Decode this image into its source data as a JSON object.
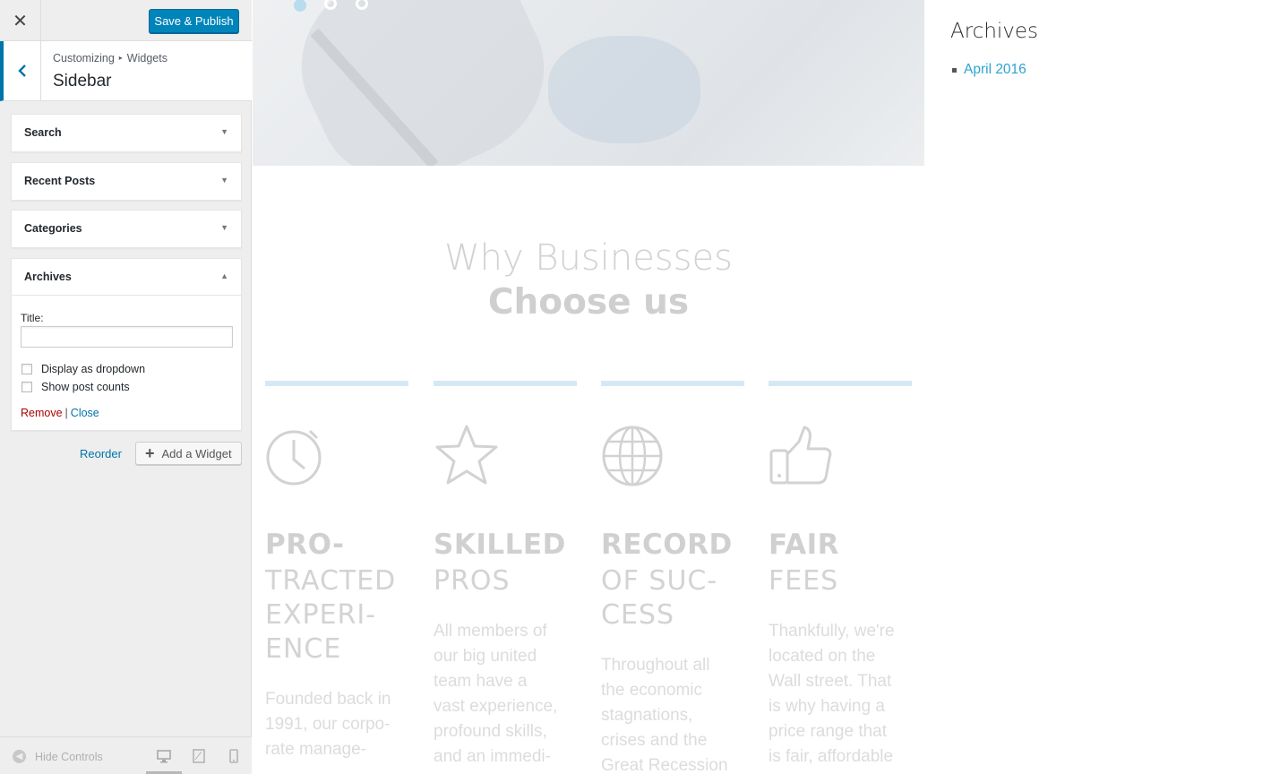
{
  "topbar": {
    "close_icon": "close-icon",
    "save_label": "Save & Publish"
  },
  "section": {
    "crumb_root": "Customizing",
    "crumb_child": "Widgets",
    "title": "Sidebar"
  },
  "widgets": [
    {
      "title": "Search",
      "expanded": false
    },
    {
      "title": "Recent Posts",
      "expanded": false
    },
    {
      "title": "Categories",
      "expanded": false
    },
    {
      "title": "Archives",
      "expanded": true
    }
  ],
  "archives_form": {
    "title_label": "Title:",
    "title_value": "",
    "cb_dropdown": "Display as dropdown",
    "cb_counts": "Show post counts",
    "remove": "Remove",
    "pipe": "|",
    "close": "Close"
  },
  "actions": {
    "reorder": "Reorder",
    "add_widget": "Add a Widget"
  },
  "footer": {
    "hide_controls": "Hide Controls"
  },
  "preview": {
    "why_title": "Why Businesses",
    "why_sub": "Choose us",
    "features": [
      {
        "icon": "stopwatch-icon",
        "head1": "PRO-",
        "head2": "TRACTED\nEXPERI-\nENCE",
        "body": "Founded back in\n1991, our corpo-\nrate manage-"
      },
      {
        "icon": "star-icon",
        "head1": "SKILLED",
        "head2": "PROS",
        "body": "All members of\nour big united\nteam have a\nvast experience,\nprofound skills,\nand an immedi-"
      },
      {
        "icon": "globe-icon",
        "head1": "RECORD",
        "head2": "OF SUC-\nCESS",
        "body": "Throughout all\nthe economic\nstagnations,\ncrises and the\nGreat Recession"
      },
      {
        "icon": "thumbs-up-icon",
        "head1": "FAIR",
        "head2": "FEES",
        "body": "Thankfully, we're\nlocated on the\nWall street. That\nis why having a\nprice range that\nis fair, affordable"
      }
    ],
    "archives_title": "Archives",
    "archives_item": "April 2016"
  },
  "colors": {
    "primary": "#0085ba",
    "link": "#0073aa",
    "remove": "#aa0000",
    "preview_link": "#2ea3d0"
  }
}
